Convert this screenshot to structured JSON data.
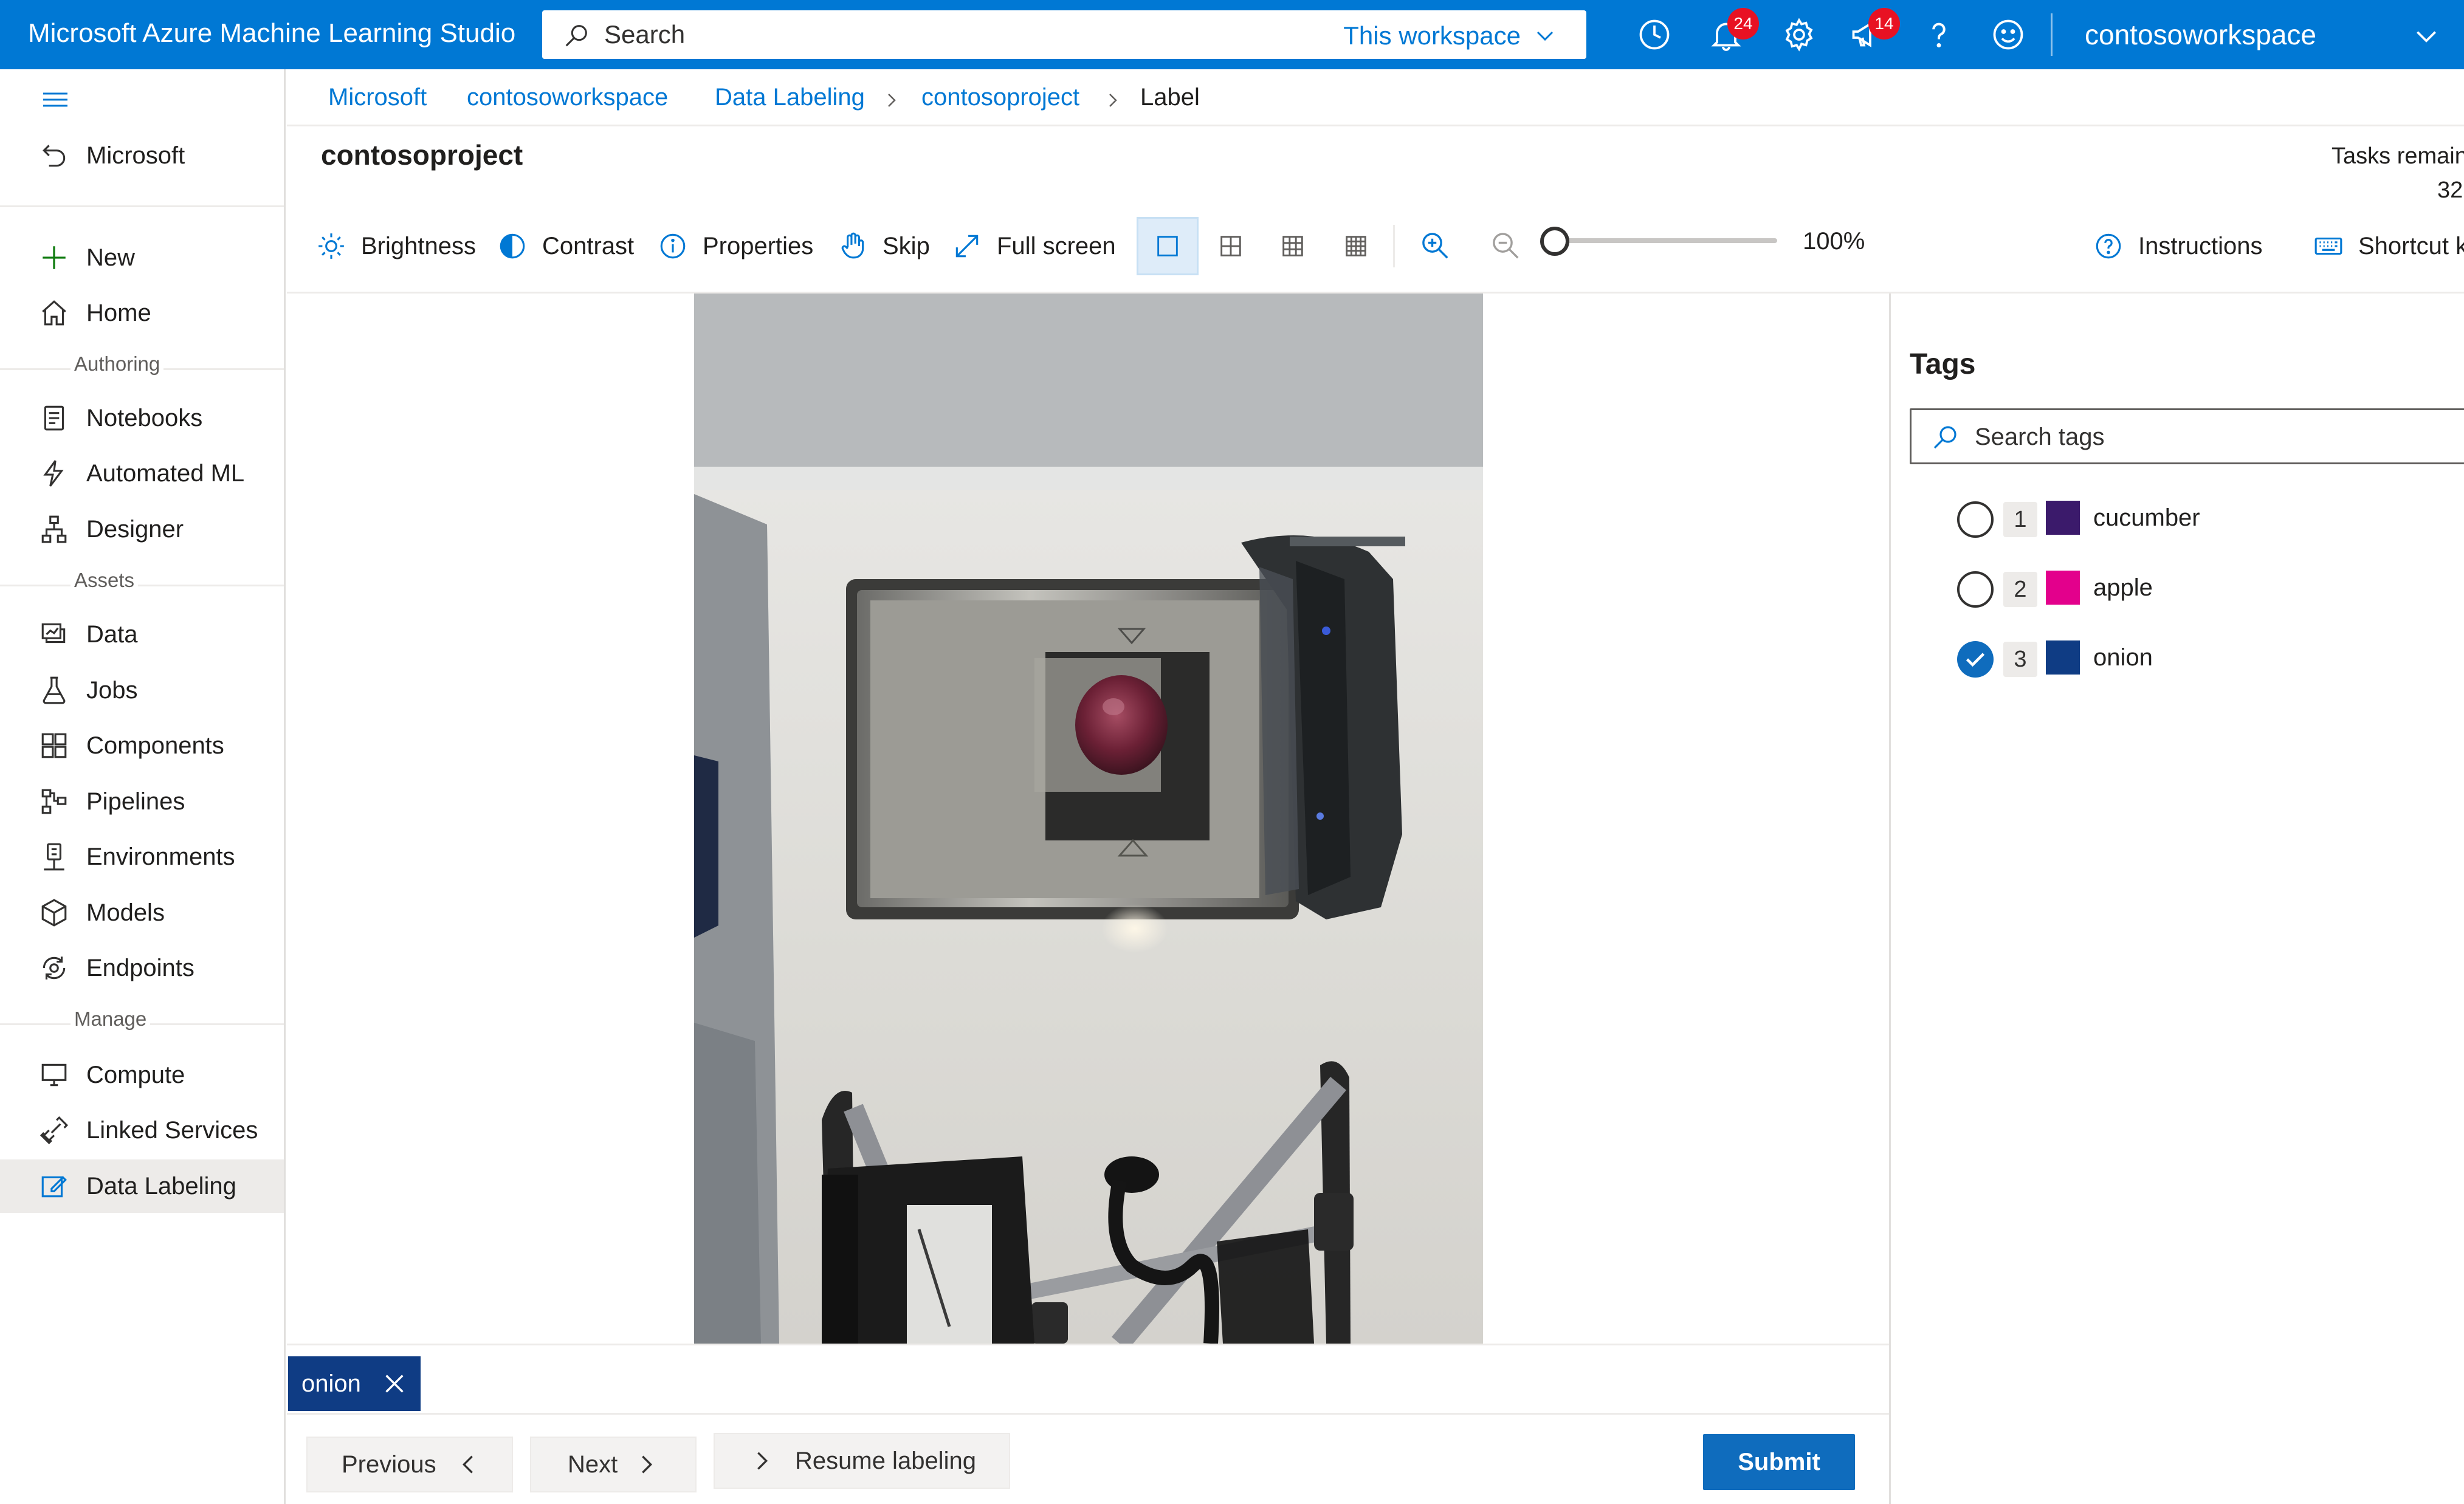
{
  "header": {
    "app_title": "Microsoft Azure Machine Learning Studio",
    "search_placeholder": "Search",
    "search_scope": "This workspace",
    "notification_count": "24",
    "announcement_count": "14",
    "workspace_name": "contosoworkspace"
  },
  "nav": {
    "back_label": "Microsoft",
    "items_top": [
      {
        "label": "New",
        "icon": "plus-icon"
      },
      {
        "label": "Home",
        "icon": "home-icon"
      }
    ],
    "section_authoring": "Authoring",
    "items_authoring": [
      {
        "label": "Notebooks",
        "icon": "notebook-icon"
      },
      {
        "label": "Automated ML",
        "icon": "automated-ml-icon"
      },
      {
        "label": "Designer",
        "icon": "designer-icon"
      }
    ],
    "section_assets": "Assets",
    "items_assets": [
      {
        "label": "Data",
        "icon": "data-icon"
      },
      {
        "label": "Jobs",
        "icon": "flask-icon"
      },
      {
        "label": "Components",
        "icon": "components-icon"
      },
      {
        "label": "Pipelines",
        "icon": "pipelines-icon"
      },
      {
        "label": "Environments",
        "icon": "environments-icon"
      },
      {
        "label": "Models",
        "icon": "cube-icon"
      },
      {
        "label": "Endpoints",
        "icon": "endpoints-icon"
      }
    ],
    "section_manage": "Manage",
    "items_manage": [
      {
        "label": "Compute",
        "icon": "monitor-icon"
      },
      {
        "label": "Linked Services",
        "icon": "link-icon"
      },
      {
        "label": "Data Labeling",
        "icon": "edit-icon",
        "active": true
      }
    ]
  },
  "breadcrumb": [
    "Microsoft",
    "contosoworkspace",
    "Data Labeling",
    "contosoproject",
    "Label"
  ],
  "project": {
    "title": "contosoproject",
    "tasks_label": "Tasks remain",
    "tasks_count": "32"
  },
  "toolbar": {
    "brightness": "Brightness",
    "contrast": "Contrast",
    "properties": "Properties",
    "skip": "Skip",
    "full_screen": "Full screen",
    "zoom_level": "100%",
    "zoom_fraction": 0,
    "instructions": "Instructions",
    "shortcut": "Shortcut k"
  },
  "selected_tag": "onion",
  "buttons": {
    "previous": "Previous",
    "next": "Next",
    "resume": "Resume labeling",
    "submit": "Submit"
  },
  "tags_panel": {
    "title": "Tags",
    "search_placeholder": "Search tags",
    "tags": [
      {
        "number": "1",
        "name": "cucumber",
        "color": "#3b1a6b",
        "checked": false
      },
      {
        "number": "2",
        "name": "apple",
        "color": "#e3008c",
        "checked": false
      },
      {
        "number": "3",
        "name": "onion",
        "color": "#0f3c84",
        "checked": true
      }
    ]
  },
  "colors": {
    "brand": "#0078d4",
    "submit": "#0f6cbd",
    "badge": "#e81123"
  }
}
